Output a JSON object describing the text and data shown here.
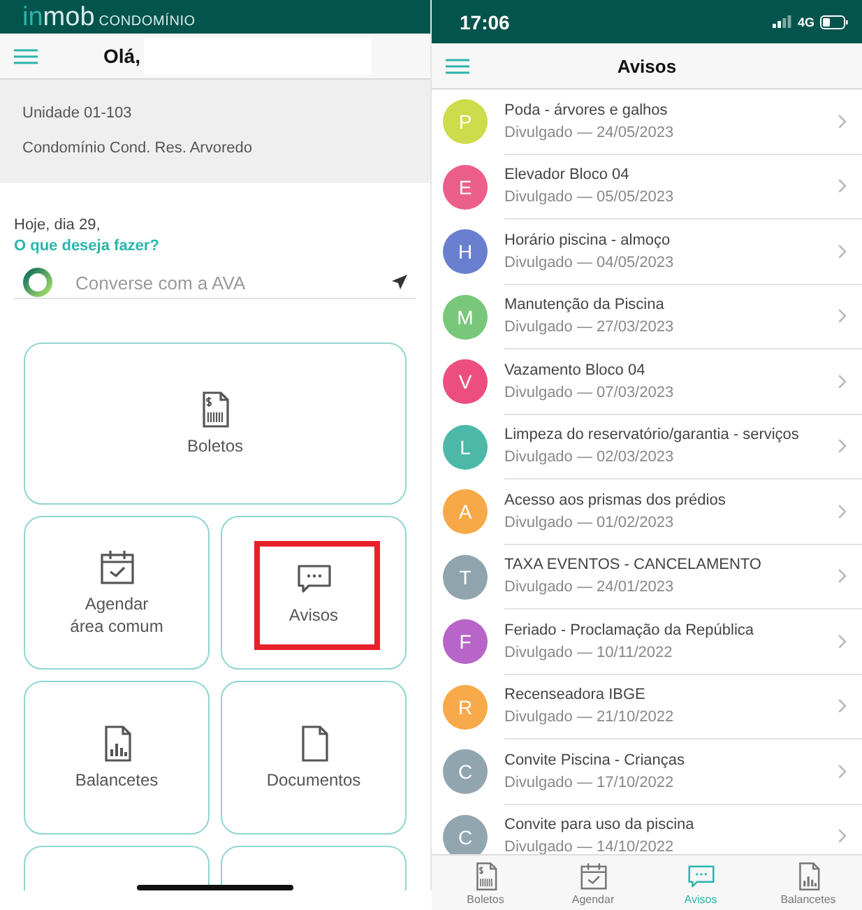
{
  "home": {
    "logo": {
      "prefix": "in",
      "main": "mob",
      "suffix": "CONDOMÍNIO"
    },
    "greeting": "Olá,",
    "unit": "Unidade 01-103",
    "condo": "Condomínio Cond. Res. Arvoredo",
    "today": "Hoje, dia 29,",
    "prompt": "O que deseja fazer?",
    "chat": {
      "placeholder": "Converse com a AVA"
    },
    "tiles": [
      {
        "kind": "boleto",
        "wide": true,
        "label": "Boletos",
        "highlighted": false
      },
      {
        "kind": "calendar",
        "wide": false,
        "label": "Agendar área comum",
        "highlighted": false
      },
      {
        "kind": "chat",
        "wide": false,
        "label": "Avisos",
        "highlighted": true
      },
      {
        "kind": "chart",
        "wide": false,
        "label": "Balancetes",
        "highlighted": false
      },
      {
        "kind": "document",
        "wide": false,
        "label": "Documentos",
        "highlighted": false
      },
      {
        "kind": "partial",
        "wide": false
      },
      {
        "kind": "partial",
        "wide": false
      }
    ]
  },
  "notices_screen": {
    "status": {
      "time": "17:06",
      "network": "4G"
    },
    "title": "Avisos",
    "notices": [
      {
        "initial": "P",
        "title": "Poda - árvores e galhos",
        "date": "Divulgado — 24/05/2023",
        "color": "#cddc4a"
      },
      {
        "initial": "E",
        "title": "Elevador Bloco 04",
        "date": "Divulgado — 05/05/2023",
        "color": "#ec5f8a"
      },
      {
        "initial": "H",
        "title": "Horário piscina - almoço",
        "date": "Divulgado — 04/05/2023",
        "color": "#6a7fd0"
      },
      {
        "initial": "M",
        "title": "Manutenção da Piscina",
        "date": "Divulgado — 27/03/2023",
        "color": "#78c77a"
      },
      {
        "initial": "V",
        "title": "Vazamento Bloco 04",
        "date": "Divulgado — 07/03/2023",
        "color": "#ec4f7f"
      },
      {
        "initial": "L",
        "title": "Limpeza do reservatório/garantia - serviços",
        "date": "Divulgado — 02/03/2023",
        "color": "#4bb8a8"
      },
      {
        "initial": "A",
        "title": "Acesso aos prismas dos prédios",
        "date": "Divulgado — 01/02/2023",
        "color": "#f7a947"
      },
      {
        "initial": "T",
        "title": "TAXA EVENTOS - CANCELAMENTO",
        "date": "Divulgado — 24/01/2023",
        "color": "#90a4ae"
      },
      {
        "initial": "F",
        "title": "Feriado - Proclamação da República",
        "date": "Divulgado — 10/11/2022",
        "color": "#b765c9"
      },
      {
        "initial": "R",
        "title": "Recenseadora IBGE",
        "date": "Divulgado — 21/10/2022",
        "color": "#f8aa4a"
      },
      {
        "initial": "C",
        "title": "Convite Piscina - Crianças",
        "date": "Divulgado — 17/10/2022",
        "color": "#91a5af"
      },
      {
        "initial": "C",
        "title": "Convite para uso da piscina",
        "date": "Divulgado — 14/10/2022",
        "color": "#92a6b0"
      }
    ],
    "tabs": [
      {
        "kind": "boleto",
        "label": "Boletos",
        "selected": false
      },
      {
        "kind": "calendar",
        "label": "Agendar",
        "selected": false
      },
      {
        "kind": "chat",
        "label": "Avisos",
        "selected": true
      },
      {
        "kind": "chart",
        "label": "Balancetes",
        "selected": false
      }
    ]
  }
}
